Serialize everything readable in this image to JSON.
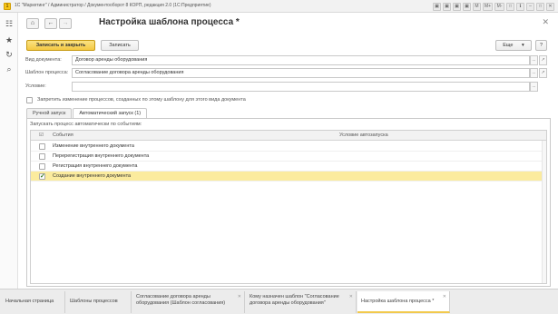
{
  "window": {
    "title": "1С \"Маркетинг\" / Администратор / Документооборот 8 КОРП, редакция 2.0  (1С:Предприятие)",
    "title_icons": [
      "▣",
      "▣",
      "▣",
      "▣",
      "M",
      "M+",
      "M-",
      "□",
      "ℹ",
      "–",
      "□",
      "✕"
    ]
  },
  "sidebar": {
    "icons": [
      "grid-icon",
      "star-icon",
      "history-icon",
      "search-icon"
    ],
    "glyphs": [
      "☷",
      "★",
      "↻",
      "⌕"
    ]
  },
  "header": {
    "home": "⌂",
    "back": "←",
    "forward": "→",
    "title": "Настройка шаблона процесса *",
    "close": "✕"
  },
  "toolbar": {
    "save_close_label": "Записать и закрыть",
    "save_label": "Записать",
    "more_label": "Еще",
    "more_arrow": "▾",
    "help_label": "?"
  },
  "fields": {
    "doc_type": {
      "label": "Вид документа:",
      "value": "Договор аренды оборудования"
    },
    "template": {
      "label": "Шаблон процесса:",
      "value": "Согласование договора аренды оборудования"
    },
    "condition": {
      "label": "Условие:",
      "value": ""
    },
    "dots": "...",
    "link": "↗"
  },
  "forbid_change": {
    "label": "Запретить изменение процессов, созданных по этому шаблону для этого вида документа",
    "checked": false
  },
  "tabs": [
    {
      "label": "Ручной запуск",
      "active": false
    },
    {
      "label": "Автоматический запуск (1)",
      "active": true
    }
  ],
  "panel": {
    "caption": "Запускать процесс автоматически по событиям:",
    "columns": {
      "check": "☑",
      "event": "События",
      "condition": "Условие автозапуска"
    },
    "rows": [
      {
        "event": "Изменение внутреннего документа",
        "checked": false,
        "selected": false
      },
      {
        "event": "Перерегистрация внутреннего документа",
        "checked": false,
        "selected": false
      },
      {
        "event": "Регистрация внутреннего документа",
        "checked": false,
        "selected": false
      },
      {
        "event": "Создание внутреннего документа",
        "checked": true,
        "selected": true
      }
    ]
  },
  "window_tabs": [
    {
      "label": "Начальная страница",
      "active": false
    },
    {
      "label": "Шаблоны процессов",
      "active": false
    },
    {
      "label": "Согласование договора аренды оборудования (Шаблон согласования)",
      "active": false
    },
    {
      "label": "Кому назначен шаблон \"Согласование договора аренды оборудования\"",
      "active": false
    },
    {
      "label": "Настройка шаблона процесса *",
      "active": true
    }
  ],
  "tab_close": "✕"
}
